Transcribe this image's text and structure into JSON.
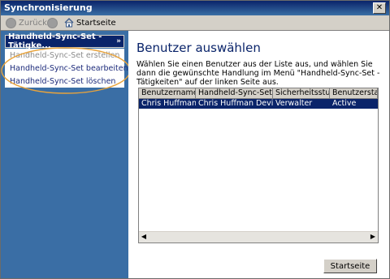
{
  "window": {
    "title": "Synchronisierung",
    "close_label": "✕"
  },
  "toolbar": {
    "back_label": "Zurück",
    "home_label": "Startseite"
  },
  "sidebar": {
    "panel_title": "Handheld-Sync-Set - Tätigke...",
    "chevron": "»",
    "tasks": [
      {
        "label": "Handheld-Sync-Set erstellen",
        "enabled": false
      },
      {
        "label": "Handheld-Sync-Set bearbeiten",
        "enabled": true
      },
      {
        "label": "Handheld-Sync-Set löschen",
        "enabled": true
      }
    ]
  },
  "main": {
    "heading": "Benutzer auswählen",
    "instruction": "Wählen Sie einen Benutzer aus der Liste aus, und wählen Sie dann die gewünschte Handlung im Menü \"Handheld-Sync-Set - Tätigkeiten\" auf der linken Seite aus.",
    "table": {
      "columns": [
        "Benutzername",
        "Handheld-Sync-Set",
        "Sicherheitsstufe",
        "Benutzerstatus"
      ],
      "rows": [
        [
          "Chris Huffman",
          "Chris Huffman Devic...",
          "Verwalter",
          "Active"
        ]
      ]
    },
    "start_button": "Startseite"
  },
  "colors": {
    "sidebar_bg": "#3a6ea5",
    "selection": "#0a246a",
    "highlight_ring": "#e8a33c"
  }
}
